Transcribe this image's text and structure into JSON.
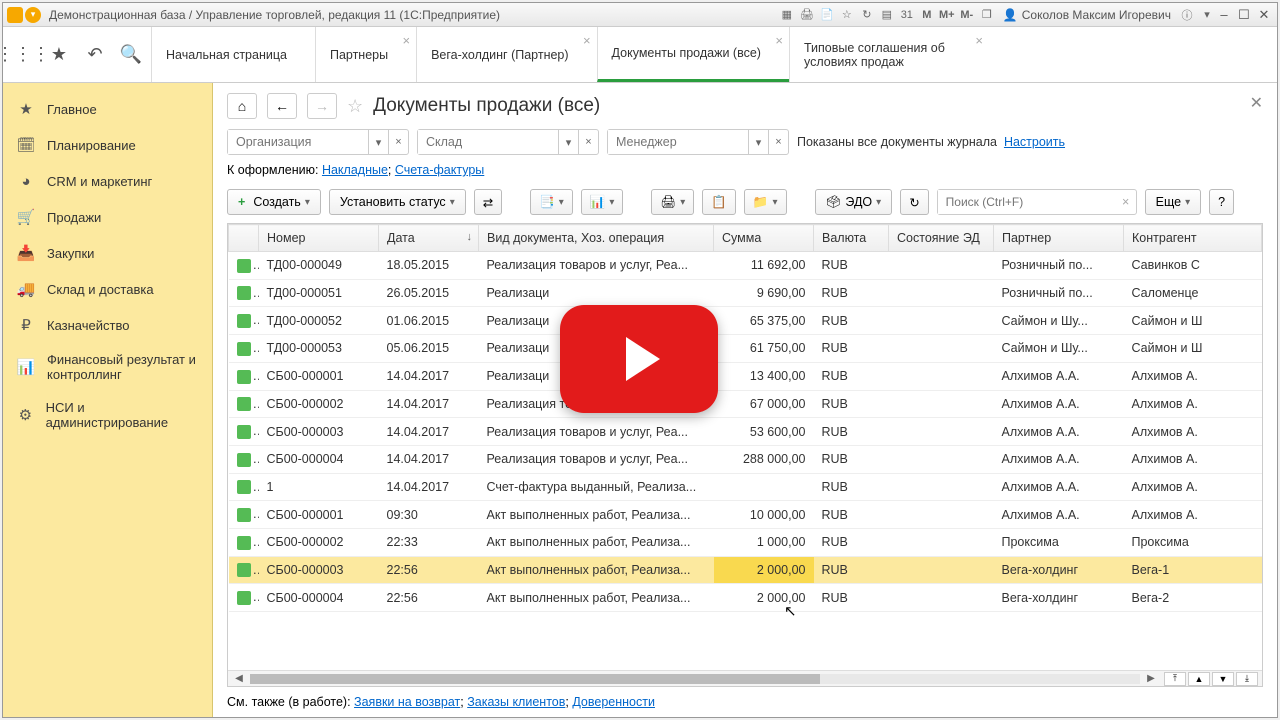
{
  "title": "Демонстрационная база / Управление торговлей, редакция 11 (1С:Предприятие)",
  "user": "Соколов Максим Игоревич",
  "m_buttons": [
    "M",
    "M+",
    "M-"
  ],
  "tabs": [
    {
      "label": "Начальная страница",
      "closable": false
    },
    {
      "label": "Партнеры",
      "closable": true
    },
    {
      "label": "Вега-холдинг (Партнер)",
      "closable": true
    },
    {
      "label": "Документы продажи (все)",
      "closable": true,
      "active": true
    },
    {
      "label": "Типовые соглашения об условиях продаж",
      "closable": true
    }
  ],
  "sidebar": [
    {
      "icon": "★",
      "label": "Главное"
    },
    {
      "icon": "🗓",
      "label": "Планирование"
    },
    {
      "icon": "◕",
      "label": "CRM и маркетинг"
    },
    {
      "icon": "🛒",
      "label": "Продажи"
    },
    {
      "icon": "📥",
      "label": "Закупки"
    },
    {
      "icon": "🚚",
      "label": "Склад и доставка"
    },
    {
      "icon": "₽",
      "label": "Казначейство"
    },
    {
      "icon": "📊",
      "label": "Финансовый результат и контроллинг"
    },
    {
      "icon": "⚙",
      "label": "НСИ и администрирование"
    }
  ],
  "page_title": "Документы продажи (все)",
  "filters": {
    "org": "Организация",
    "warehouse": "Склад",
    "manager": "Менеджер",
    "shown_text": "Показаны все документы журнала",
    "configure": "Настроить"
  },
  "links_row": {
    "prefix": "К оформлению:",
    "l1": "Накладные",
    "l2": "Счета-фактуры"
  },
  "toolbar": {
    "create": "Создать",
    "set_status": "Установить статус",
    "edo": "ЭДО",
    "more": "Еще",
    "search_ph": "Поиск (Ctrl+F)"
  },
  "columns": [
    "",
    "Номер",
    "Дата",
    "Вид документа, Хоз. операция",
    "Сумма",
    "Валюта",
    "Состояние ЭД",
    "Партнер",
    "Контрагент"
  ],
  "rows": [
    {
      "n": "ТД00-000049",
      "d": "18.05.2015",
      "t": "Реализация товаров и услуг, Реа...",
      "s": "11 692,00",
      "c": "RUB",
      "p": "Розничный по...",
      "k": "Савинков С"
    },
    {
      "n": "ТД00-000051",
      "d": "26.05.2015",
      "t": "Реализаци",
      "s": "9 690,00",
      "c": "RUB",
      "p": "Розничный по...",
      "k": "Саломенце"
    },
    {
      "n": "ТД00-000052",
      "d": "01.06.2015",
      "t": "Реализаци",
      "s": "65 375,00",
      "c": "RUB",
      "p": "Саймон и Шу...",
      "k": "Саймон и Ш"
    },
    {
      "n": "ТД00-000053",
      "d": "05.06.2015",
      "t": "Реализаци",
      "s": "61 750,00",
      "c": "RUB",
      "p": "Саймон и Шу...",
      "k": "Саймон и Ш"
    },
    {
      "n": "СБ00-000001",
      "d": "14.04.2017",
      "t": "Реализаци",
      "s": "13 400,00",
      "c": "RUB",
      "p": "Алхимов А.А.",
      "k": "Алхимов А."
    },
    {
      "n": "СБ00-000002",
      "d": "14.04.2017",
      "t": "Реализация товаров и услуг, Реа...",
      "s": "67 000,00",
      "c": "RUB",
      "p": "Алхимов А.А.",
      "k": "Алхимов А."
    },
    {
      "n": "СБ00-000003",
      "d": "14.04.2017",
      "t": "Реализация товаров и услуг, Реа...",
      "s": "53 600,00",
      "c": "RUB",
      "p": "Алхимов А.А.",
      "k": "Алхимов А."
    },
    {
      "n": "СБ00-000004",
      "d": "14.04.2017",
      "t": "Реализация товаров и услуг, Реа...",
      "s": "288 000,00",
      "c": "RUB",
      "p": "Алхимов А.А.",
      "k": "Алхимов А."
    },
    {
      "n": "1",
      "d": "14.04.2017",
      "t": "Счет-фактура выданный, Реализа...",
      "s": "",
      "c": "RUB",
      "p": "Алхимов А.А.",
      "k": "Алхимов А."
    },
    {
      "n": "СБ00-000001",
      "d": "09:30",
      "t": "Акт выполненных работ, Реализа...",
      "s": "10 000,00",
      "c": "RUB",
      "p": "Алхимов А.А.",
      "k": "Алхимов А."
    },
    {
      "n": "СБ00-000002",
      "d": "22:33",
      "t": "Акт выполненных работ, Реализа...",
      "s": "1 000,00",
      "c": "RUB",
      "p": "Проксима",
      "k": "Проксима"
    },
    {
      "n": "СБ00-000003",
      "d": "22:56",
      "t": "Акт выполненных работ, Реализа...",
      "s": "2 000,00",
      "c": "RUB",
      "p": "Вега-холдинг",
      "k": "Вега-1",
      "sel": true
    },
    {
      "n": "СБ00-000004",
      "d": "22:56",
      "t": "Акт выполненных работ, Реализа...",
      "s": "2 000,00",
      "c": "RUB",
      "p": "Вега-холдинг",
      "k": "Вега-2"
    }
  ],
  "footer": {
    "prefix": "См. также (в работе):",
    "l1": "Заявки на возврат",
    "l2": "Заказы клиентов",
    "l3": "Доверенности"
  }
}
